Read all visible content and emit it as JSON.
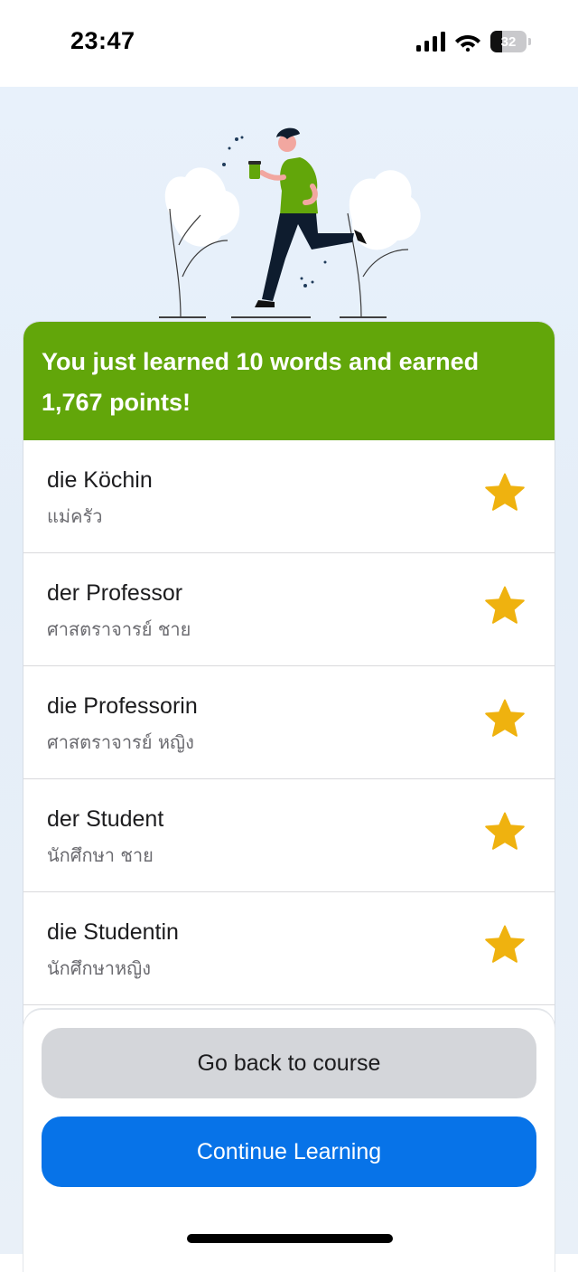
{
  "status_bar": {
    "time": "23:47",
    "battery_percent": "32",
    "battery_level": 0.32,
    "icons": [
      "signal-icon",
      "wifi-icon",
      "battery-icon"
    ]
  },
  "hero": {
    "illustration": "runner-illustration"
  },
  "summary": {
    "message": "You just learned 10 words and earned 1,767 points!",
    "accent_color": "#62a60a"
  },
  "words": [
    {
      "german": "die Köchin",
      "thai": "แม่ครัว",
      "starred": true
    },
    {
      "german": "der Professor",
      "thai": "ศาสตราจารย์ ชาย",
      "starred": true
    },
    {
      "german": "die Professorin",
      "thai": "ศาสตราจารย์ หญิง",
      "starred": true
    },
    {
      "german": "der Student",
      "thai": "นักศึกษา ชาย",
      "starred": true
    },
    {
      "german": "die Studentin",
      "thai": "นักศึกษาหญิง",
      "starred": true
    }
  ],
  "actions": {
    "back_label": "Go back to course",
    "continue_label": "Continue Learning",
    "primary_color": "#0773e8",
    "star_color": "#efb20f"
  }
}
